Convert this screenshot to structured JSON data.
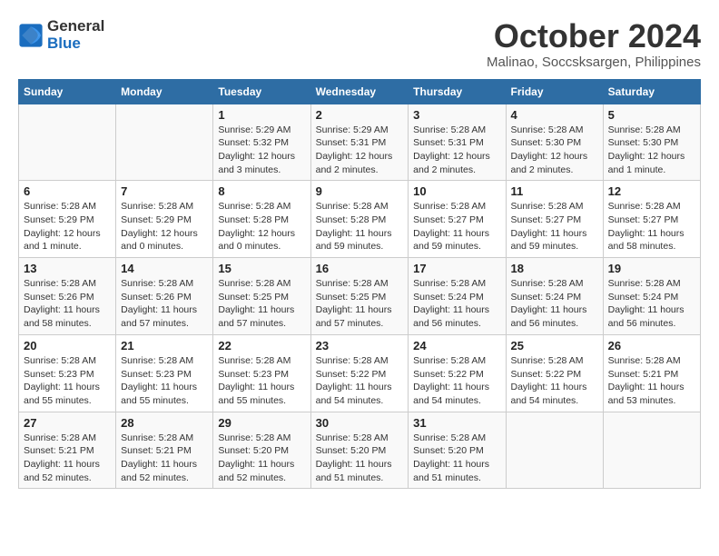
{
  "logo": {
    "text_general": "General",
    "text_blue": "Blue"
  },
  "title": "October 2024",
  "location": "Malinao, Soccsksargen, Philippines",
  "headers": [
    "Sunday",
    "Monday",
    "Tuesday",
    "Wednesday",
    "Thursday",
    "Friday",
    "Saturday"
  ],
  "weeks": [
    [
      {
        "day": "",
        "info": ""
      },
      {
        "day": "",
        "info": ""
      },
      {
        "day": "1",
        "info": "Sunrise: 5:29 AM\nSunset: 5:32 PM\nDaylight: 12 hours and 3 minutes."
      },
      {
        "day": "2",
        "info": "Sunrise: 5:29 AM\nSunset: 5:31 PM\nDaylight: 12 hours and 2 minutes."
      },
      {
        "day": "3",
        "info": "Sunrise: 5:28 AM\nSunset: 5:31 PM\nDaylight: 12 hours and 2 minutes."
      },
      {
        "day": "4",
        "info": "Sunrise: 5:28 AM\nSunset: 5:30 PM\nDaylight: 12 hours and 2 minutes."
      },
      {
        "day": "5",
        "info": "Sunrise: 5:28 AM\nSunset: 5:30 PM\nDaylight: 12 hours and 1 minute."
      }
    ],
    [
      {
        "day": "6",
        "info": "Sunrise: 5:28 AM\nSunset: 5:29 PM\nDaylight: 12 hours and 1 minute."
      },
      {
        "day": "7",
        "info": "Sunrise: 5:28 AM\nSunset: 5:29 PM\nDaylight: 12 hours and 0 minutes."
      },
      {
        "day": "8",
        "info": "Sunrise: 5:28 AM\nSunset: 5:28 PM\nDaylight: 12 hours and 0 minutes."
      },
      {
        "day": "9",
        "info": "Sunrise: 5:28 AM\nSunset: 5:28 PM\nDaylight: 11 hours and 59 minutes."
      },
      {
        "day": "10",
        "info": "Sunrise: 5:28 AM\nSunset: 5:27 PM\nDaylight: 11 hours and 59 minutes."
      },
      {
        "day": "11",
        "info": "Sunrise: 5:28 AM\nSunset: 5:27 PM\nDaylight: 11 hours and 59 minutes."
      },
      {
        "day": "12",
        "info": "Sunrise: 5:28 AM\nSunset: 5:27 PM\nDaylight: 11 hours and 58 minutes."
      }
    ],
    [
      {
        "day": "13",
        "info": "Sunrise: 5:28 AM\nSunset: 5:26 PM\nDaylight: 11 hours and 58 minutes."
      },
      {
        "day": "14",
        "info": "Sunrise: 5:28 AM\nSunset: 5:26 PM\nDaylight: 11 hours and 57 minutes."
      },
      {
        "day": "15",
        "info": "Sunrise: 5:28 AM\nSunset: 5:25 PM\nDaylight: 11 hours and 57 minutes."
      },
      {
        "day": "16",
        "info": "Sunrise: 5:28 AM\nSunset: 5:25 PM\nDaylight: 11 hours and 57 minutes."
      },
      {
        "day": "17",
        "info": "Sunrise: 5:28 AM\nSunset: 5:24 PM\nDaylight: 11 hours and 56 minutes."
      },
      {
        "day": "18",
        "info": "Sunrise: 5:28 AM\nSunset: 5:24 PM\nDaylight: 11 hours and 56 minutes."
      },
      {
        "day": "19",
        "info": "Sunrise: 5:28 AM\nSunset: 5:24 PM\nDaylight: 11 hours and 56 minutes."
      }
    ],
    [
      {
        "day": "20",
        "info": "Sunrise: 5:28 AM\nSunset: 5:23 PM\nDaylight: 11 hours and 55 minutes."
      },
      {
        "day": "21",
        "info": "Sunrise: 5:28 AM\nSunset: 5:23 PM\nDaylight: 11 hours and 55 minutes."
      },
      {
        "day": "22",
        "info": "Sunrise: 5:28 AM\nSunset: 5:23 PM\nDaylight: 11 hours and 55 minutes."
      },
      {
        "day": "23",
        "info": "Sunrise: 5:28 AM\nSunset: 5:22 PM\nDaylight: 11 hours and 54 minutes."
      },
      {
        "day": "24",
        "info": "Sunrise: 5:28 AM\nSunset: 5:22 PM\nDaylight: 11 hours and 54 minutes."
      },
      {
        "day": "25",
        "info": "Sunrise: 5:28 AM\nSunset: 5:22 PM\nDaylight: 11 hours and 54 minutes."
      },
      {
        "day": "26",
        "info": "Sunrise: 5:28 AM\nSunset: 5:21 PM\nDaylight: 11 hours and 53 minutes."
      }
    ],
    [
      {
        "day": "27",
        "info": "Sunrise: 5:28 AM\nSunset: 5:21 PM\nDaylight: 11 hours and 52 minutes."
      },
      {
        "day": "28",
        "info": "Sunrise: 5:28 AM\nSunset: 5:21 PM\nDaylight: 11 hours and 52 minutes."
      },
      {
        "day": "29",
        "info": "Sunrise: 5:28 AM\nSunset: 5:20 PM\nDaylight: 11 hours and 52 minutes."
      },
      {
        "day": "30",
        "info": "Sunrise: 5:28 AM\nSunset: 5:20 PM\nDaylight: 11 hours and 51 minutes."
      },
      {
        "day": "31",
        "info": "Sunrise: 5:28 AM\nSunset: 5:20 PM\nDaylight: 11 hours and 51 minutes."
      },
      {
        "day": "",
        "info": ""
      },
      {
        "day": "",
        "info": ""
      }
    ]
  ]
}
